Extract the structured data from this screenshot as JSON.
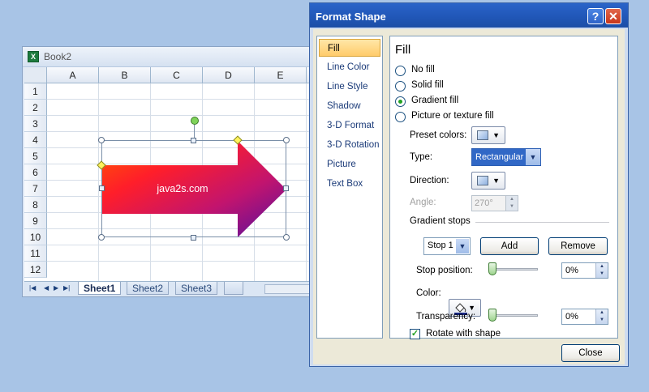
{
  "workbook": {
    "title": "Book2",
    "columns": [
      "A",
      "B",
      "C",
      "D",
      "E"
    ],
    "rows": [
      "1",
      "2",
      "3",
      "4",
      "5",
      "6",
      "7",
      "8",
      "9",
      "10",
      "11",
      "12"
    ],
    "shape_text": "java2s.com",
    "sheets": [
      "Sheet1",
      "Sheet2",
      "Sheet3"
    ],
    "active_sheet": "Sheet1"
  },
  "dialog": {
    "title": "Format Shape",
    "help_glyph": "?",
    "close_glyph": "✕",
    "nav": [
      "Fill",
      "Line Color",
      "Line Style",
      "Shadow",
      "3-D Format",
      "3-D Rotation",
      "Picture",
      "Text Box"
    ],
    "nav_selected": "Fill",
    "fill": {
      "heading": "Fill",
      "options": [
        "No fill",
        "Solid fill",
        "Gradient fill",
        "Picture or texture fill"
      ],
      "selected_option": "Gradient fill",
      "preset_colors_label": "Preset colors:",
      "type_label": "Type:",
      "type_value": "Rectangular",
      "direction_label": "Direction:",
      "angle_label": "Angle:",
      "angle_value": "270°",
      "gradient_stops_label": "Gradient stops",
      "stop_value": "Stop 1",
      "add_label": "Add",
      "remove_label": "Remove",
      "stop_position_label": "Stop position:",
      "stop_position_value": "0%",
      "stop_position_level": 0,
      "color_label": "Color:",
      "transparency_label": "Transparency:",
      "transparency_value": "0%",
      "transparency_level": 0,
      "rotate_label": "Rotate with shape",
      "rotate_checked": true
    },
    "close_button": "Close"
  },
  "colors": {
    "desktop": "#a8c4e6",
    "title_bar": "#2157b8",
    "gradient_start": "#ff3a1f",
    "gradient_end": "#5a0a9e",
    "selection": "#ffcb6a"
  },
  "icons": [
    "excel-app-icon",
    "help-icon",
    "close-icon",
    "dropdown-arrow-icon",
    "paint-bucket-icon",
    "check-icon"
  ]
}
